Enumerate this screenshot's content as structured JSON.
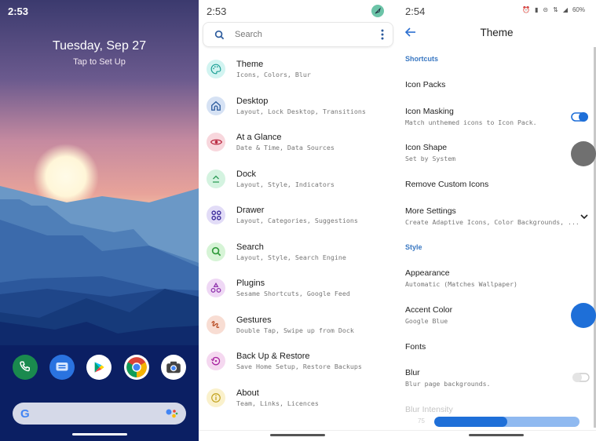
{
  "lockscreen": {
    "time": "2:53",
    "date": "Tuesday, Sep 27",
    "subtitle": "Tap to Set Up",
    "dock_apps": [
      {
        "name": "phone",
        "icon": "phone-icon",
        "color": "#1a8a4e"
      },
      {
        "name": "messages",
        "icon": "messages-icon",
        "color": "#2a73e0"
      },
      {
        "name": "play-store",
        "icon": "play-store-icon",
        "color": "#ffffff"
      },
      {
        "name": "chrome",
        "icon": "chrome-icon",
        "color": "#ffffff"
      },
      {
        "name": "camera",
        "icon": "camera-icon",
        "color": "#ffffff"
      }
    ],
    "search_logo": "G"
  },
  "settings": {
    "time": "2:53",
    "search_placeholder": "Search",
    "items": [
      {
        "title": "Theme",
        "subtitle": "Icons, Colors, Blur",
        "icon": "palette-icon",
        "bg": "#d2f4f1",
        "fg": "#1c9e95"
      },
      {
        "title": "Desktop",
        "subtitle": "Layout, Lock Desktop, Transitions",
        "icon": "home-icon",
        "bg": "#d6e2f4",
        "fg": "#2b5a9c"
      },
      {
        "title": "At a Glance",
        "subtitle": "Date & Time, Data Sources",
        "icon": "eye-icon",
        "bg": "#f8d7dd",
        "fg": "#b8243c"
      },
      {
        "title": "Dock",
        "subtitle": "Layout, Style, Indicators",
        "icon": "dock-icon",
        "bg": "#d4f3e0",
        "fg": "#2b9a55"
      },
      {
        "title": "Drawer",
        "subtitle": "Layout, Categories, Suggestions",
        "icon": "grid-icon",
        "bg": "#e2dcf7",
        "fg": "#3b2a9c"
      },
      {
        "title": "Search",
        "subtitle": "Layout, Style, Search Engine",
        "icon": "search-icon",
        "bg": "#d6f4d6",
        "fg": "#2e9a3a"
      },
      {
        "title": "Plugins",
        "subtitle": "Sesame Shortcuts, Google Feed",
        "icon": "shapes-icon",
        "bg": "#efd8f5",
        "fg": "#8a2aa8"
      },
      {
        "title": "Gestures",
        "subtitle": "Double Tap, Swipe up from Dock",
        "icon": "gesture-icon",
        "bg": "#f8ddd3",
        "fg": "#b84a22"
      },
      {
        "title": "Back Up & Restore",
        "subtitle": "Save Home Setup, Restore Backups",
        "icon": "restore-icon",
        "bg": "#f5d8f0",
        "fg": "#a822a0"
      },
      {
        "title": "About",
        "subtitle": "Team, Links, Licences",
        "icon": "info-icon",
        "bg": "#faf1cc",
        "fg": "#c2a11a"
      }
    ]
  },
  "theme": {
    "time": "2:54",
    "battery": "60%",
    "title": "Theme",
    "sections": {
      "shortcuts": "Shortcuts",
      "style": "Style"
    },
    "rows": {
      "icon_packs": {
        "title": "Icon Packs"
      },
      "icon_masking": {
        "title": "Icon Masking",
        "subtitle": "Match unthemed icons to Icon Pack.",
        "enabled": true
      },
      "icon_shape": {
        "title": "Icon Shape",
        "subtitle": "Set by System",
        "swatch": "#707070"
      },
      "remove_custom_icons": {
        "title": "Remove Custom Icons"
      },
      "more_settings": {
        "title": "More Settings",
        "subtitle": "Create Adaptive Icons, Color Backgrounds, ..."
      },
      "appearance": {
        "title": "Appearance",
        "subtitle": "Automatic (Matches Wallpaper)"
      },
      "accent_color": {
        "title": "Accent Color",
        "subtitle": "Google Blue",
        "swatch": "#1e6fd8"
      },
      "fonts": {
        "title": "Fonts"
      },
      "blur": {
        "title": "Blur",
        "subtitle": "Blur page backgrounds.",
        "enabled": false
      },
      "blur_intensity": {
        "title": "Blur Intensity",
        "value": "75",
        "fraction": 0.5
      }
    }
  }
}
